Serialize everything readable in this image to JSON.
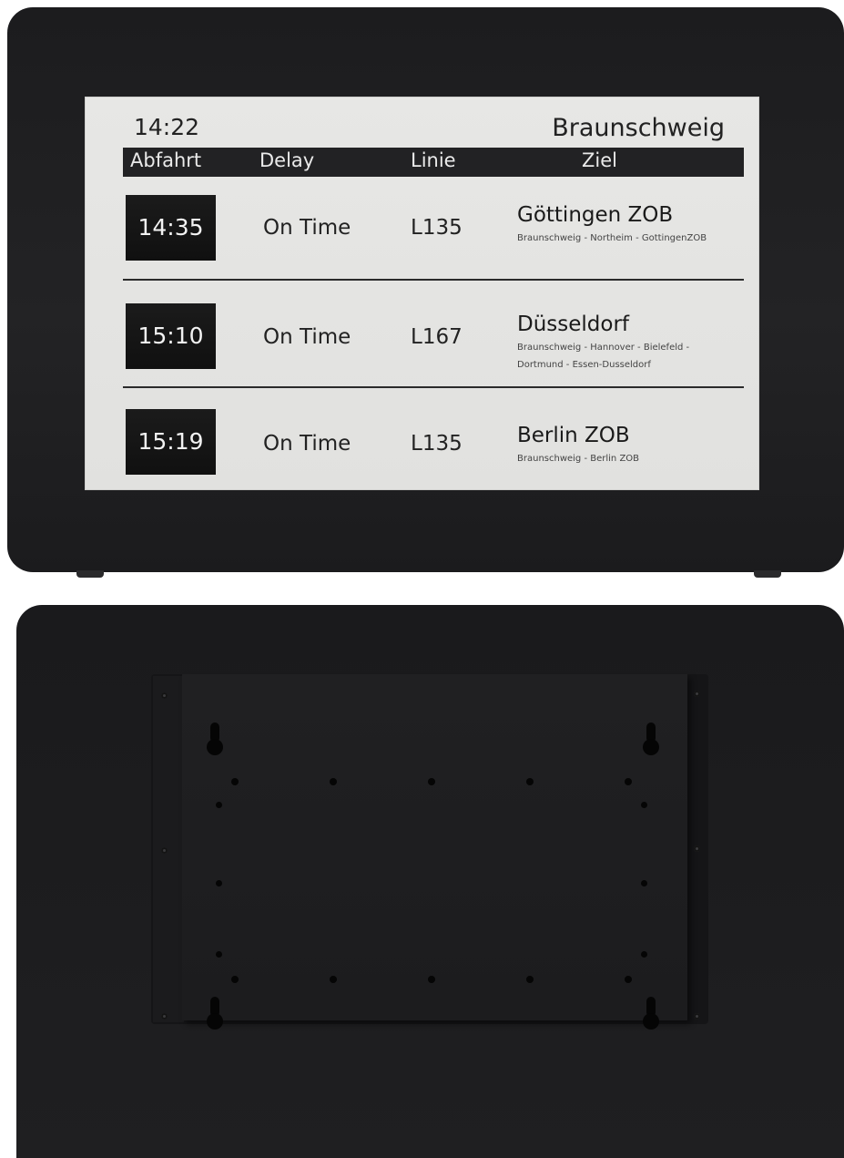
{
  "display": {
    "clock": "14:22",
    "station": "Braunschweig",
    "headers": {
      "departure": "Abfahrt",
      "delay": "Delay",
      "line": "Linie",
      "destination": "Ziel"
    },
    "departures": [
      {
        "time": "14:35",
        "delay": "On Time",
        "line": "L135",
        "destination": "Göttingen ZOB",
        "via": [
          "Braunschweig - Northeim - GottingenZOB"
        ]
      },
      {
        "time": "15:10",
        "delay": "On Time",
        "line": "L167",
        "destination": "Düsseldorf",
        "via": [
          "Braunschweig - Hannover - Bielefeld -",
          "Dortmund - Essen-Dusseldorf"
        ]
      },
      {
        "time": "15:19",
        "delay": "On Time",
        "line": "L135",
        "destination": "Berlin ZOB",
        "via": [
          "Braunschweig - Berlin ZOB"
        ]
      }
    ]
  },
  "colors": {
    "bezel": "#1f1f21",
    "screen": "#e4e4e2",
    "header_bar": "#222224",
    "time_box": "#141414"
  }
}
